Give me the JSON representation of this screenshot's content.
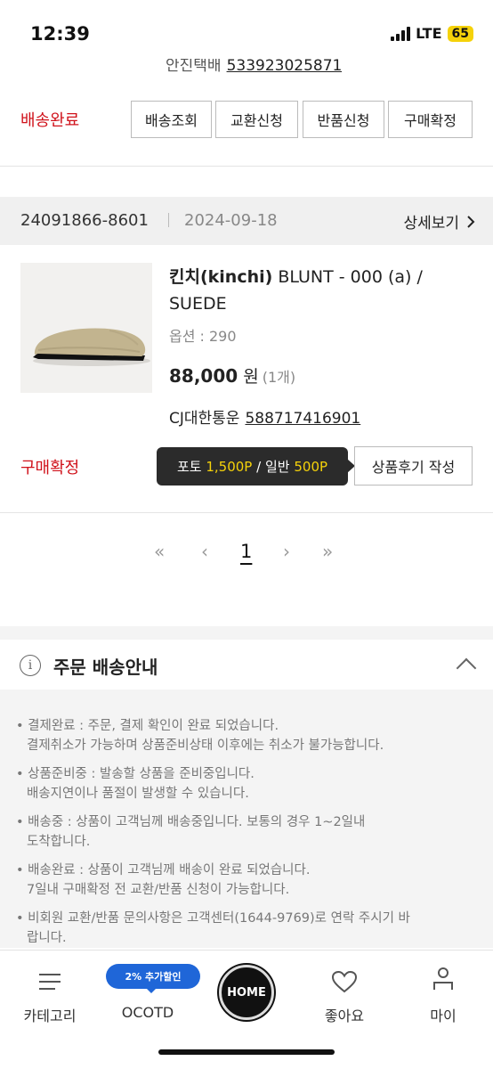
{
  "status_bar": {
    "time": "12:39",
    "network": "LTE",
    "battery": "65"
  },
  "prev_order": {
    "carrier_partial": "안진택배",
    "tracking_partial": "533923025871",
    "status": "배송완료",
    "buttons": [
      "배송조회",
      "교환신청",
      "반품신청",
      "구매확정"
    ]
  },
  "order": {
    "number": "24091866-8601",
    "date": "2024-09-18",
    "detail_label": "상세보기",
    "product": {
      "brand": "킨치(kinchi)",
      "name_rest": " BLUNT - 000 (a) / SUEDE",
      "option": "옵션 : 290",
      "price": "88,000",
      "currency": "원",
      "quantity": "(1개)",
      "carrier": "CJ대한통운",
      "tracking": "588717416901"
    },
    "status": "구매확정",
    "tooltip": {
      "photo_label": "포토",
      "photo_points": "1,500P",
      "sep": "/",
      "normal_label": "일반",
      "normal_points": "500P"
    },
    "review_button": "상품후기 작성"
  },
  "pagination": {
    "first": "«",
    "prev": "‹",
    "current": "1",
    "next": "›",
    "last": "»"
  },
  "info": {
    "title": "주문 배송안내",
    "items": [
      {
        "line1": "결제완료 : 주문, 결제 확인이 완료 되었습니다.",
        "line2": "결제취소가 가능하며 상품준비상태 이후에는 취소가 불가능합니다."
      },
      {
        "line1": "상품준비중 : 발송할 상품을 준비중입니다.",
        "line2": "배송지연이나 품절이 발생할 수 있습니다."
      },
      {
        "line1": "배송중 : 상품이 고객님께 배송중입니다. 보통의 경우 1~2일내",
        "line2": "도착합니다."
      },
      {
        "line1": "배송완료 : 상품이 고객님께 배송이 완료 되었습니다.",
        "line2": "7일내 구매확정 전 교환/반품 신청이 가능합니다."
      },
      {
        "line1": "비회원 교환/반품 문의사항은 고객센터(1644-9769)로 연락 주시기 바",
        "line2": "랍니다."
      }
    ]
  },
  "tabbar": {
    "category": "카테고리",
    "ocotd": "OCOTD",
    "ocotd_badge": "2% 추가할인",
    "home": "HOME",
    "like": "좋아요",
    "my": "마이"
  }
}
